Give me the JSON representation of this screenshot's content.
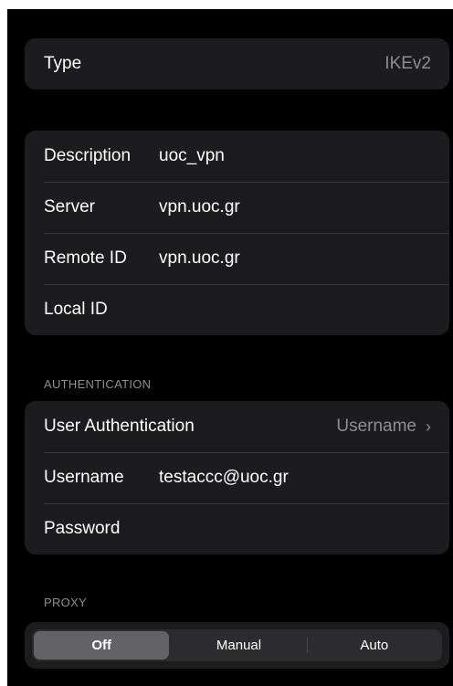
{
  "type_group": {
    "label": "Type",
    "value": "IKEv2"
  },
  "connection": {
    "description_label": "Description",
    "description_value": "uoc_vpn",
    "server_label": "Server",
    "server_value": "vpn.uoc.gr",
    "remote_id_label": "Remote ID",
    "remote_id_value": "vpn.uoc.gr",
    "local_id_label": "Local ID",
    "local_id_value": ""
  },
  "authentication": {
    "header": "AUTHENTICATION",
    "user_auth_label": "User Authentication",
    "user_auth_value": "Username",
    "username_label": "Username",
    "username_value": "testaccc@uoc.gr",
    "password_label": "Password",
    "password_value": ""
  },
  "proxy": {
    "header": "PROXY",
    "options": [
      "Off",
      "Manual",
      "Auto"
    ],
    "selected": "Off"
  },
  "colors": {
    "background": "#000000",
    "group": "#1c1c1e",
    "secondary_text": "#8d8d93"
  },
  "icons": {
    "disclosure": "chevron-right-icon"
  }
}
